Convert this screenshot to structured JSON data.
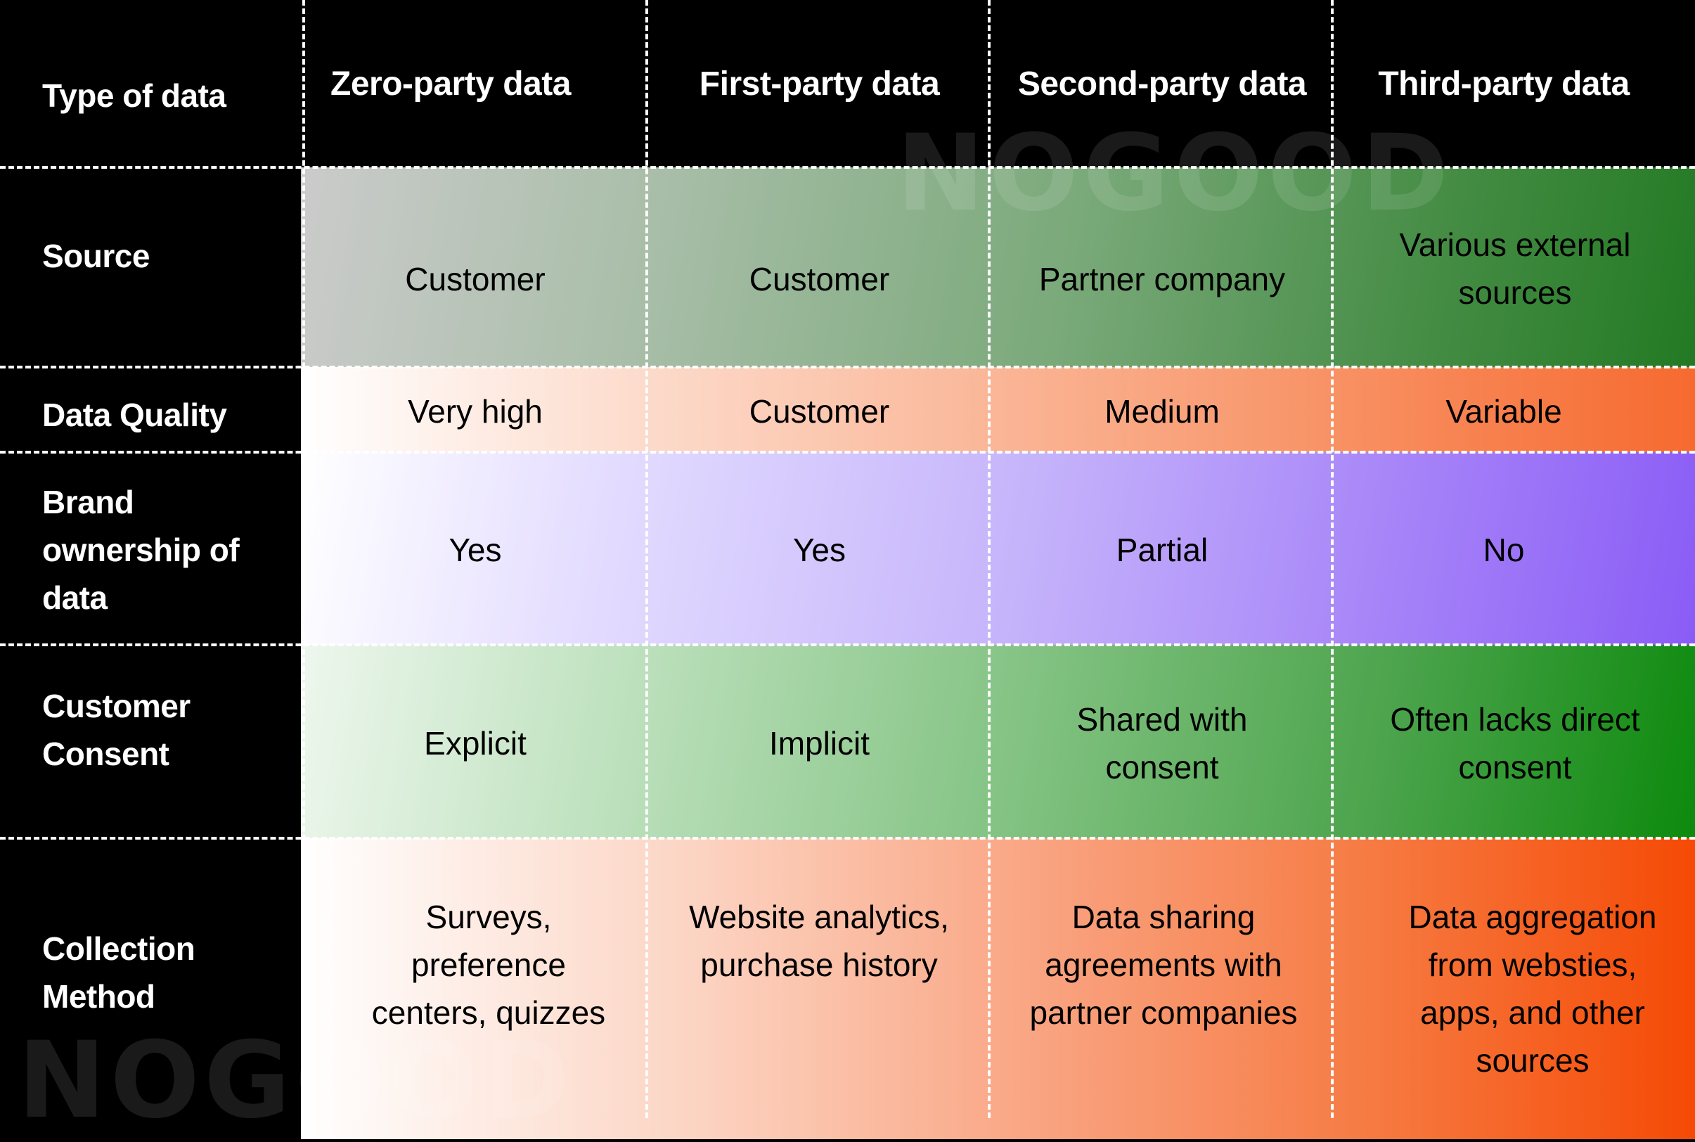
{
  "header": {
    "corner_label": "Type of data",
    "columns": [
      "Zero-party data",
      "First-party data",
      "Second-party data",
      "Third-party data"
    ]
  },
  "rows": [
    {
      "label": "Source",
      "cells": [
        "Customer",
        "Customer",
        "Partner company",
        "Various external sources"
      ]
    },
    {
      "label": "Data Quality",
      "cells": [
        "Very high",
        "Customer",
        "Medium",
        "Variable"
      ]
    },
    {
      "label": "Brand ownership of data",
      "cells": [
        "Yes",
        "Yes",
        "Partial",
        "No"
      ]
    },
    {
      "label": "Customer Consent",
      "cells": [
        "Explicit",
        "Implicit",
        "Shared with consent",
        "Often lacks direct consent"
      ]
    },
    {
      "label": "Collection Method",
      "cells": [
        "Surveys, preference centers, quizzes",
        "Website analytics, purchase history",
        "Data sharing agreements with partner companies",
        "Data aggregation from websties, apps, and other sources"
      ]
    }
  ],
  "watermark": "NOGOOD",
  "colors": {
    "background": "#000000",
    "source_gradient": [
      "#cccccc",
      "#237a23"
    ],
    "quality_gradient": [
      "#ffffff",
      "#f66a2f"
    ],
    "ownership_gradient": [
      "#ffffff",
      "#8a5cf6"
    ],
    "consent_gradient": [
      "#eef7ee",
      "#0d8a0d"
    ],
    "method_gradient": [
      "#ffffff",
      "#f54a05"
    ]
  }
}
